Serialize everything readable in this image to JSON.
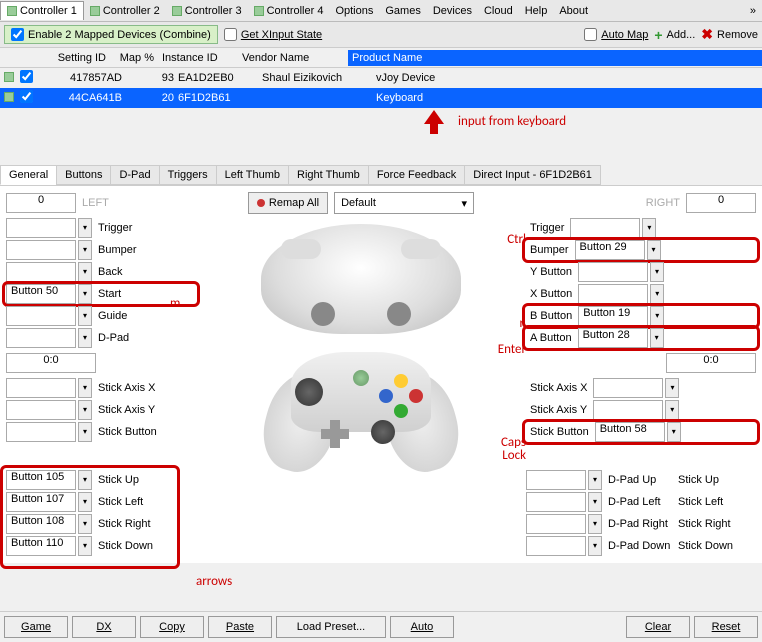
{
  "menubar": {
    "tabs": [
      "Controller 1",
      "Controller 2",
      "Controller 3",
      "Controller 4"
    ],
    "items": [
      "Options",
      "Games",
      "Devices",
      "Cloud",
      "Help",
      "About"
    ]
  },
  "toolbar": {
    "combine": "Enable 2 Mapped Devices (Combine)",
    "getxinput": "Get XInput State",
    "automap": "Auto Map",
    "add": "Add...",
    "remove": "Remove"
  },
  "headers": {
    "setting": "Setting ID",
    "map": "Map %",
    "instance": "Instance ID",
    "vendor": "Vendor Name",
    "product": "Product Name"
  },
  "rows": [
    {
      "id": "417857AD",
      "map": "93",
      "inst": "EA1D2EB0",
      "vendor": "Shaul Eizikovich",
      "product": "vJoy Device",
      "sel": false,
      "chk": true
    },
    {
      "id": "44CA641B",
      "map": "20",
      "inst": "6F1D2B61",
      "vendor": "",
      "product": "Keyboard",
      "sel": true,
      "chk": true
    }
  ],
  "anno": {
    "input": "input from keyboard",
    "m": "m",
    "arrows": "arrows",
    "ctrl": "Ctrl",
    "r": "r",
    "enter": "Enter",
    "caps": "Caps Lock"
  },
  "tabs2": [
    "General",
    "Buttons",
    "D-Pad",
    "Triggers",
    "Left Thumb",
    "Right Thumb",
    "Force Feedback",
    "Direct Input - 6F1D2B61"
  ],
  "remap": "Remap All",
  "default": "Default",
  "left": {
    "hdr": "LEFT",
    "num": "0",
    "coord": "0:0",
    "items": [
      {
        "v": "",
        "l": "Trigger"
      },
      {
        "v": "",
        "l": "Bumper"
      },
      {
        "v": "",
        "l": "Back"
      },
      {
        "v": "Button 50",
        "l": "Start",
        "hl": true
      },
      {
        "v": "",
        "l": "Guide"
      },
      {
        "v": "",
        "l": "D-Pad"
      }
    ],
    "axes": [
      {
        "v": "",
        "l": "Stick Axis X"
      },
      {
        "v": "",
        "l": "Stick Axis Y"
      },
      {
        "v": "",
        "l": "Stick Button"
      }
    ],
    "dpad": [
      {
        "v": "Button 105",
        "l": "Stick Up"
      },
      {
        "v": "Button 107",
        "l": "Stick Left"
      },
      {
        "v": "Button 108",
        "l": "Stick Right"
      },
      {
        "v": "Button 110",
        "l": "Stick Down"
      }
    ]
  },
  "right": {
    "hdr": "RIGHT",
    "num": "0",
    "coord": "0:0",
    "items": [
      {
        "v": "",
        "l": "Trigger"
      },
      {
        "v": "Button 29",
        "l": "Bumper",
        "hl": true
      },
      {
        "v": "",
        "l": "Y Button"
      },
      {
        "v": "",
        "l": "X Button"
      },
      {
        "v": "Button 19",
        "l": "B Button",
        "hl": true
      },
      {
        "v": "Button 28",
        "l": "A Button",
        "hl": true
      }
    ],
    "axes": [
      {
        "v": "",
        "l": "Stick Axis X"
      },
      {
        "v": "",
        "l": "Stick Axis Y"
      },
      {
        "v": "Button 58",
        "l": "Stick Button",
        "hl": true
      }
    ],
    "dpad": [
      {
        "v": "",
        "l": "D-Pad Up",
        "r": "Stick Up"
      },
      {
        "v": "",
        "l": "D-Pad Left",
        "r": "Stick Left"
      },
      {
        "v": "",
        "l": "D-Pad Right",
        "r": "Stick Right"
      },
      {
        "v": "",
        "l": "D-Pad Down",
        "r": "Stick Down"
      }
    ]
  },
  "bottom": {
    "game": "Game",
    "dx": "DX",
    "copy": "Copy",
    "paste": "Paste",
    "load": "Load Preset...",
    "auto": "Auto",
    "clear": "Clear",
    "reset": "Reset"
  }
}
